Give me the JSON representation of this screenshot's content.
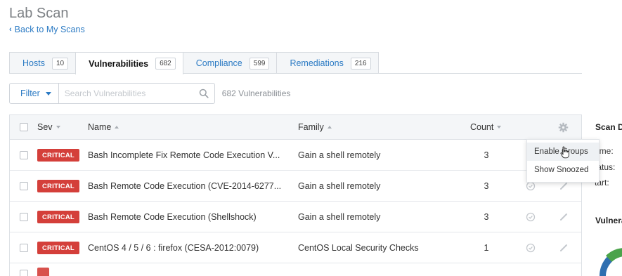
{
  "header": {
    "title": "Lab Scan",
    "back_link": "Back to My Scans"
  },
  "tabs": [
    {
      "label": "Hosts",
      "count": "10",
      "active": false
    },
    {
      "label": "Vulnerabilities",
      "count": "682",
      "active": true
    },
    {
      "label": "Compliance",
      "count": "599",
      "active": false
    },
    {
      "label": "Remediations",
      "count": "216",
      "active": false
    }
  ],
  "filter": {
    "button_label": "Filter",
    "search_placeholder": "Search Vulnerabilities",
    "result_count": "682 Vulnerabilities"
  },
  "table": {
    "columns": {
      "sev": "Sev",
      "name": "Name",
      "family": "Family",
      "count": "Count"
    },
    "rows": [
      {
        "severity": "CRITICAL",
        "name": "Bash Incomplete Fix Remote Code Execution V...",
        "family": "Gain a shell remotely",
        "count": "3"
      },
      {
        "severity": "CRITICAL",
        "name": "Bash Remote Code Execution (CVE-2014-6277...",
        "family": "Gain a shell remotely",
        "count": "3"
      },
      {
        "severity": "CRITICAL",
        "name": "Bash Remote Code Execution (Shellshock)",
        "family": "Gain a shell remotely",
        "count": "3"
      },
      {
        "severity": "CRITICAL",
        "name": "CentOS 4 / 5 / 6 : firefox (CESA-2012:0079)",
        "family": "CentOS Local Security Checks",
        "count": "1"
      }
    ]
  },
  "settings_menu": {
    "items": [
      "Enable Groups",
      "Show Snoozed"
    ]
  },
  "side_panel": {
    "title": "Scan D",
    "fields": [
      "ame:",
      "tatus:",
      "tart:"
    ],
    "section": "Vulnera"
  },
  "colors": {
    "accent": "#2c7bc4",
    "critical": "#d43f3a",
    "tab_bg": "#f4f6f8"
  }
}
